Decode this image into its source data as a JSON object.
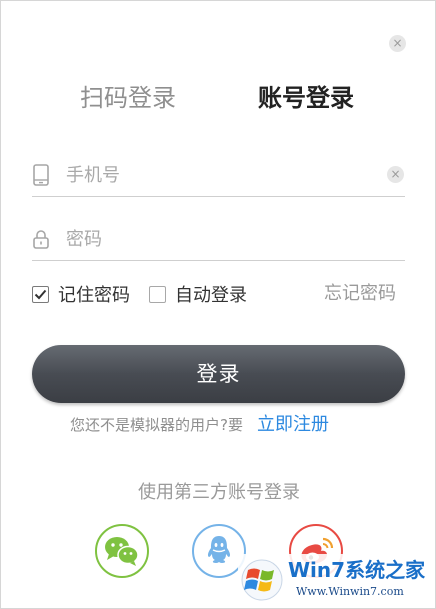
{
  "dialog": {
    "close_symbol": "×",
    "close_icon": "close-icon"
  },
  "tabs": [
    {
      "label": "扫码登录",
      "active": false
    },
    {
      "label": "账号登录",
      "active": true
    }
  ],
  "phone_field": {
    "placeholder": "手机号",
    "value": "",
    "icon": "phone-icon",
    "clear_symbol": "×"
  },
  "password_field": {
    "placeholder": "密码",
    "value": "",
    "icon": "lock-icon"
  },
  "options": {
    "remember_label": "记住密码",
    "remember_checked": true,
    "auto_login_label": "自动登录",
    "auto_login_checked": false,
    "forgot_label": "忘记密码"
  },
  "login_button": {
    "label": "登录"
  },
  "register": {
    "prompt": "您还不是模拟器的用户?要",
    "link_label": "立即注册"
  },
  "third_party": {
    "title": "使用第三方账号登录",
    "providers": [
      {
        "icon": "wechat-icon",
        "color": "#7fc241"
      },
      {
        "icon": "qq-icon",
        "color": "#75b3e8"
      },
      {
        "icon": "weibo-icon",
        "color": "#e84a43"
      }
    ]
  },
  "watermark": {
    "brand": "Win7系统之家",
    "url": "Www.Winwin7.com"
  },
  "colors": {
    "link": "#2d89e0",
    "muted": "#9a9a9a",
    "button": "#484c53"
  }
}
